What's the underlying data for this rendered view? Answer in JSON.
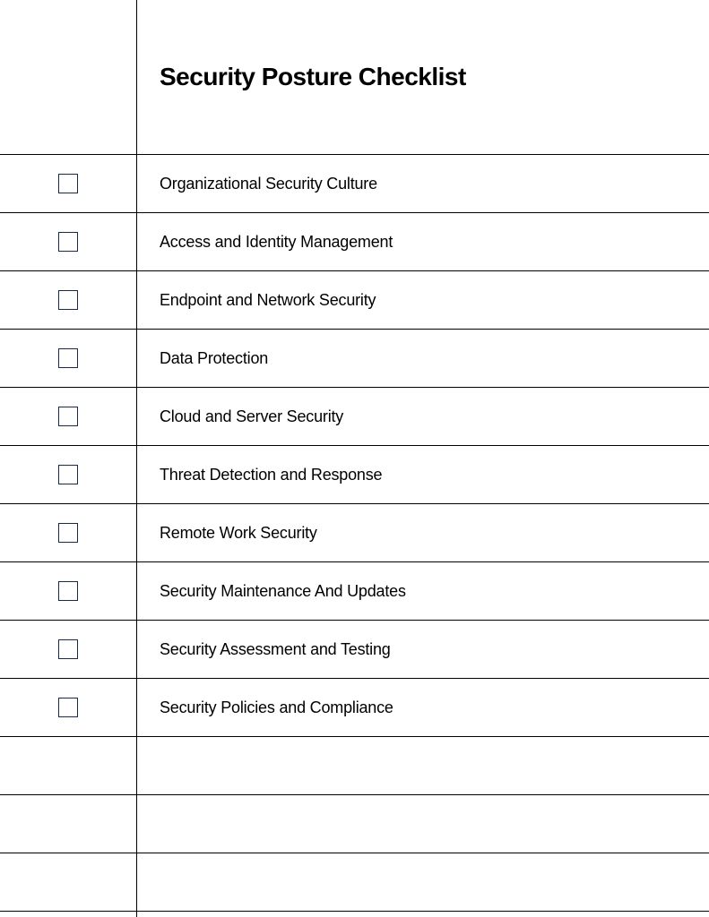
{
  "title": "Security Posture Checklist",
  "items": [
    {
      "label": "Organizational Security Culture",
      "checked": false
    },
    {
      "label": "Access and Identity Management",
      "checked": false
    },
    {
      "label": "Endpoint and Network Security",
      "checked": false
    },
    {
      "label": "Data Protection",
      "checked": false
    },
    {
      "label": "Cloud and Server Security",
      "checked": false
    },
    {
      "label": "Threat Detection and Response",
      "checked": false
    },
    {
      "label": "Remote Work Security",
      "checked": false
    },
    {
      "label": "Security Maintenance And Updates",
      "checked": false
    },
    {
      "label": "Security Assessment and Testing",
      "checked": false
    },
    {
      "label": "Security Policies and Compliance",
      "checked": false
    },
    {
      "label": "",
      "checked": null
    },
    {
      "label": "",
      "checked": null
    },
    {
      "label": "",
      "checked": null
    }
  ]
}
